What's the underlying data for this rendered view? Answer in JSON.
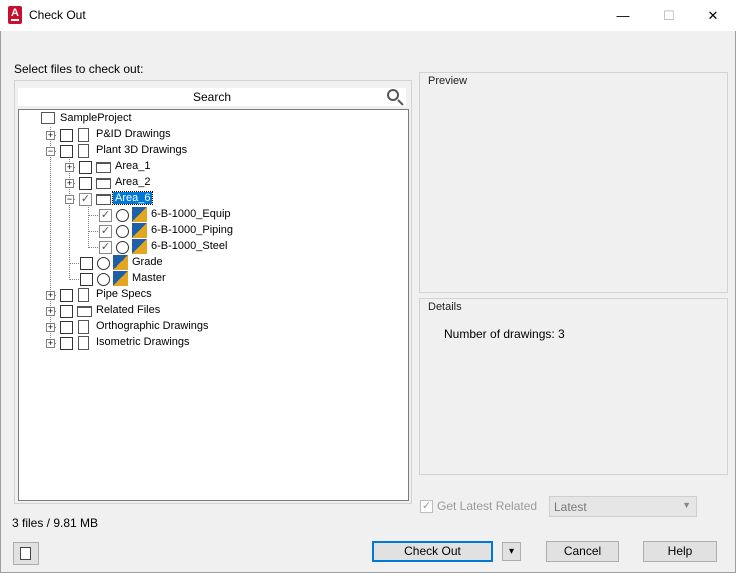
{
  "window": {
    "title": "Check Out",
    "app_icon_letter": "A",
    "minimize": "—",
    "maximize": "☐",
    "close": "✕"
  },
  "instructions": "Select files to check out:",
  "search": {
    "label": "Search"
  },
  "tree": {
    "root": "SampleProject",
    "pid": "P&ID Drawings",
    "plant3d": "Plant 3D Drawings",
    "area1": "Area_1",
    "area2": "Area_2",
    "area6": "Area_6",
    "equip": "6-B-1000_Equip",
    "piping": "6-B-1000_Piping",
    "steel": "6-B-1000_Steel",
    "grade": "Grade",
    "master": "Master",
    "pipespecs": "Pipe Specs",
    "related": "Related Files",
    "ortho": "Orthographic Drawings",
    "iso": "Isometric Drawings"
  },
  "preview": {
    "title": "Preview"
  },
  "details": {
    "title": "Details",
    "text": "Number of drawings: 3"
  },
  "get_latest": {
    "label": "Get Latest Related",
    "checked": true,
    "enabled": false
  },
  "version_select": {
    "value": "Latest"
  },
  "status": "3 files / 9.81 MB",
  "buttons": {
    "checkout": "Check Out",
    "cancel": "Cancel",
    "help": "Help",
    "split_arrow": "▾"
  },
  "colors": {
    "accent": "#0078d7",
    "dwg_blue": "#1f5fa8",
    "dwg_yellow": "#e4a521",
    "app_red": "#c8102e"
  }
}
